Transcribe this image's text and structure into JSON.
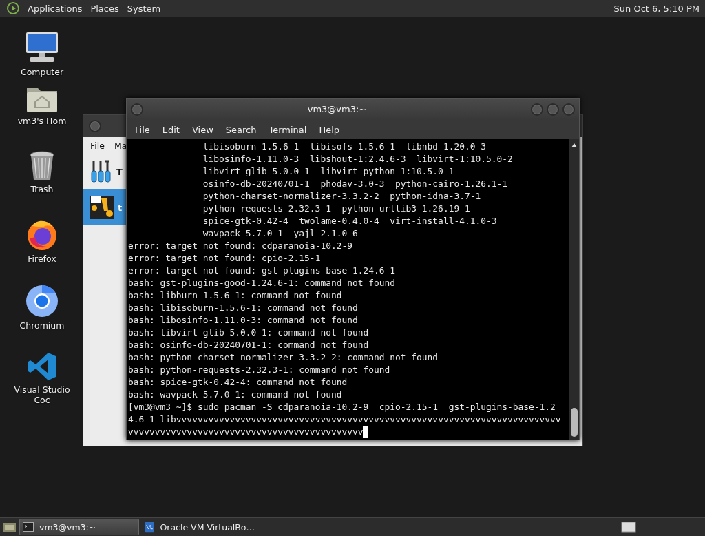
{
  "top_panel": {
    "menus": [
      "Applications",
      "Places",
      "System"
    ],
    "clock": "Sun Oct  6, 5:10 PM"
  },
  "desktop_icons": [
    {
      "label": "Computer",
      "kind": "computer"
    },
    {
      "label": "vm3's Hom",
      "kind": "home"
    },
    {
      "label": "Trash",
      "kind": "trash"
    },
    {
      "label": "Firefox",
      "kind": "firefox"
    },
    {
      "label": "Chromium",
      "kind": "chromium"
    },
    {
      "label": "Visual Studio Coc",
      "kind": "vscode"
    }
  ],
  "back_window": {
    "menus": [
      "File",
      "Ma"
    ],
    "items": [
      {
        "label": "T",
        "kind": "tools",
        "selected": false
      },
      {
        "label": "t",
        "kind": "vm",
        "selected": true
      }
    ]
  },
  "terminal": {
    "title": "vm3@vm3:~",
    "menus": [
      "File",
      "Edit",
      "View",
      "Search",
      "Terminal",
      "Help"
    ],
    "lines": [
      {
        "kind": "continued",
        "text": "libisoburn-1.5.6-1  libisofs-1.5.6-1  libnbd-1.20.0-3"
      },
      {
        "kind": "continued",
        "text": "libosinfo-1.11.0-3  libshout-1:2.4.6-3  libvirt-1:10.5.0-2"
      },
      {
        "kind": "continued",
        "text": "libvirt-glib-5.0.0-1  libvirt-python-1:10.5.0-1"
      },
      {
        "kind": "continued",
        "text": "osinfo-db-20240701-1  phodav-3.0-3  python-cairo-1.26.1-1"
      },
      {
        "kind": "continued",
        "text": "python-charset-normalizer-3.3.2-2  python-idna-3.7-1"
      },
      {
        "kind": "continued",
        "text": "python-requests-2.32.3-1  python-urllib3-1.26.19-1"
      },
      {
        "kind": "continued",
        "text": "spice-gtk-0.42-4  twolame-0.4.0-4  virt-install-4.1.0-3"
      },
      {
        "kind": "continued",
        "text": "wavpack-5.7.0-1  yajl-2.1.0-6"
      },
      {
        "kind": "output",
        "text": "error: target not found: cdparanoia-10.2-9"
      },
      {
        "kind": "output",
        "text": "error: target not found: cpio-2.15-1"
      },
      {
        "kind": "output",
        "text": "error: target not found: gst-plugins-base-1.24.6-1"
      },
      {
        "kind": "output",
        "text": "bash: gst-plugins-good-1.24.6-1: command not found"
      },
      {
        "kind": "output",
        "text": "bash: libburn-1.5.6-1: command not found"
      },
      {
        "kind": "output",
        "text": "bash: libisoburn-1.5.6-1: command not found"
      },
      {
        "kind": "output",
        "text": "bash: libosinfo-1.11.0-3: command not found"
      },
      {
        "kind": "output",
        "text": "bash: libvirt-glib-5.0.0-1: command not found"
      },
      {
        "kind": "output",
        "text": "bash: osinfo-db-20240701-1: command not found"
      },
      {
        "kind": "output",
        "text": "bash: python-charset-normalizer-3.3.2-2: command not found"
      },
      {
        "kind": "output",
        "text": "bash: python-requests-2.32.3-1: command not found"
      },
      {
        "kind": "output",
        "text": "bash: spice-gtk-0.42-4: command not found"
      },
      {
        "kind": "output",
        "text": "bash: wavpack-5.7.0-1: command not found"
      }
    ],
    "prompt": "[vm3@vm3 ~]$ sudo pacman -S cdparanoia-10.2-9  cpio-2.15-1  gst-plugins-base-1.24.6-1 libvvvvvvvvvvvvvvvvvvvvvvvvvvvvvvvvvvvvvvvvvvvvvvvvvvvvvvvvvvvvvvvvvvvvvvvvvvvvvvvvvvvvvvvvvvvvvvvvvvvvvvvvvvvvvvvvvvvv"
  },
  "taskbar": {
    "tasks": [
      {
        "label": "vm3@vm3:~",
        "kind": "terminal",
        "selected": true
      },
      {
        "label": "Oracle VM VirtualBo…",
        "kind": "virtualbox",
        "selected": false
      }
    ]
  }
}
